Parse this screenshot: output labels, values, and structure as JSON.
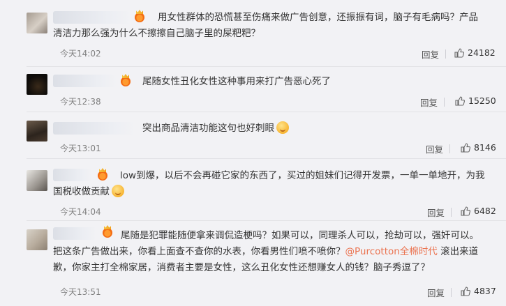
{
  "comments": [
    {
      "text": "用女性群体的恐慌甚至伤痛来做广告创意，还振振有词，脑子有毛病吗？产品清洁力那么强为什么不擦擦自己脑子里的屎粑粑？",
      "time": "今天14:02",
      "reply_label": "回复",
      "likes": "24182"
    },
    {
      "text": "尾随女性丑化女性这种事用来打广告恶心死了",
      "time": "今天12:38",
      "reply_label": "回复",
      "likes": "15250"
    },
    {
      "text": "突出商品清洁功能这句也好刺眼",
      "time": "今天13:01",
      "reply_label": "回复",
      "likes": "8146"
    },
    {
      "text": "low到爆，以后不会再碰它家的东西了，买过的姐妹们记得开发票，一单一单地开，为我国税收做贡献",
      "time": "今天14:04",
      "reply_label": "回复",
      "likes": "6482"
    },
    {
      "text_before": "尾随是犯罪能随便拿来调侃造梗吗？如果可以，同理杀人可以，抢劫可以，强奸可以。把这条广告做出来，你看上面查不查你的水表，你看男性们喷不喷你？",
      "mention": "@Purcotton全棉时代",
      "text_after": " 滚出来道歉，你家主打全棉家居，消费者主要是女性，这么丑化女性还想赚女人的钱？脑子秀逗了？",
      "time": "今天13:51",
      "reply_label": "回复",
      "likes": "4837"
    }
  ],
  "colors": {
    "background": "#f2f2f5",
    "mention": "#eb7350",
    "timestamp": "#808080"
  },
  "icons": {
    "like": "thumbs-up-icon",
    "badge": "crown-badge-icon",
    "emoji": "smiley-emoji-icon"
  }
}
